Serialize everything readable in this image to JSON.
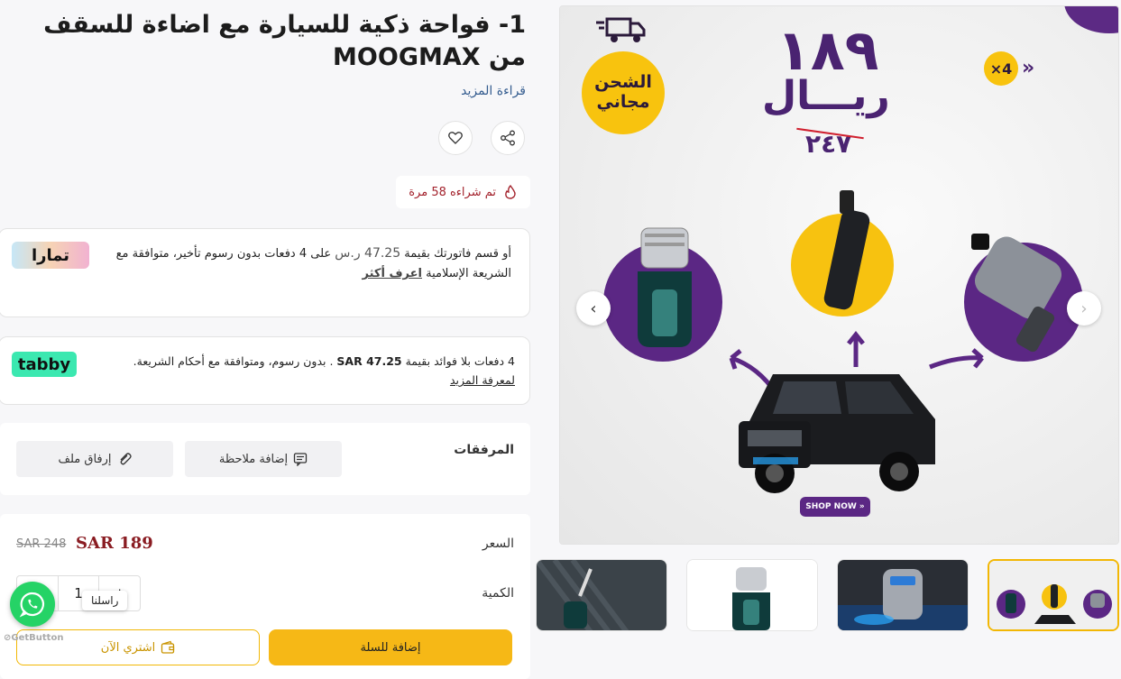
{
  "product": {
    "title": "1- فواحة ذكية للسيارة مع اضاءة للسقف من MOOGMAX",
    "read_more": "قراءة المزيد",
    "sold_count_text": "تم شراءه 58 مرة"
  },
  "gallery": {
    "shipping_badge": "الشحن مجاني",
    "price_text": "١٨٩",
    "currency_text": "ريـــال",
    "old_price_text": "٢٤٧",
    "multiplier": "×4",
    "shop_now": "SHOP NOW"
  },
  "tamara": {
    "text_before": "أو قسم فاتورتك بقيمة",
    "amount": "47.25 ر.س",
    "text_after": "على 4 دفعات بدون رسوم تأخير، متوافقة مع الشريعة الإسلامية",
    "learn_more": "اعرف أكثر",
    "logo_text": "تمارا"
  },
  "tabby": {
    "text_before": "4 دفعات بلا فوائد بقيمة",
    "amount": "SAR 47.25",
    "text_after": ". بدون رسوم، ومتوافقة مع أحكام الشريعة.",
    "learn_more": "لمعرفة المزيد",
    "logo_text": "tabby"
  },
  "attachments": {
    "label": "المرفقات",
    "add_note": "إضافة ملاحظة",
    "attach_file": "إرفاق ملف"
  },
  "pricing": {
    "price_label": "السعر",
    "current_price": "SAR 189",
    "old_price": "SAR 248",
    "quantity_label": "الكمية",
    "quantity_value": "1",
    "plus": "+",
    "minus": "-"
  },
  "actions": {
    "add_to_cart": "إضافة للسلة",
    "buy_now": "اشتري الآن"
  },
  "widget": {
    "tooltip": "راسلنا",
    "brand": "GetButton"
  },
  "colors": {
    "accent_yellow": "#f6b816",
    "brand_purple": "#5b2784",
    "price_red": "#8a1c22",
    "whatsapp_green": "#25d366",
    "tabby_green": "#3be8b0"
  }
}
